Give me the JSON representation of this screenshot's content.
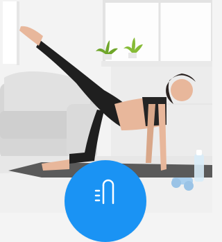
{
  "scene": {
    "subject": "woman-exercising-on-mat",
    "setting": "bright-living-room"
  },
  "badge": {
    "icon": "thermometer-icon",
    "color": "#1a93f4"
  },
  "colors": {
    "wall": "#f4f4f4",
    "window": "#ffffff",
    "sofa": "#d9d9d9",
    "mat": "#5a5a5a",
    "outfit": "#1f1f1f",
    "skin": "#e8b79b",
    "plant": "#7ab22e"
  }
}
